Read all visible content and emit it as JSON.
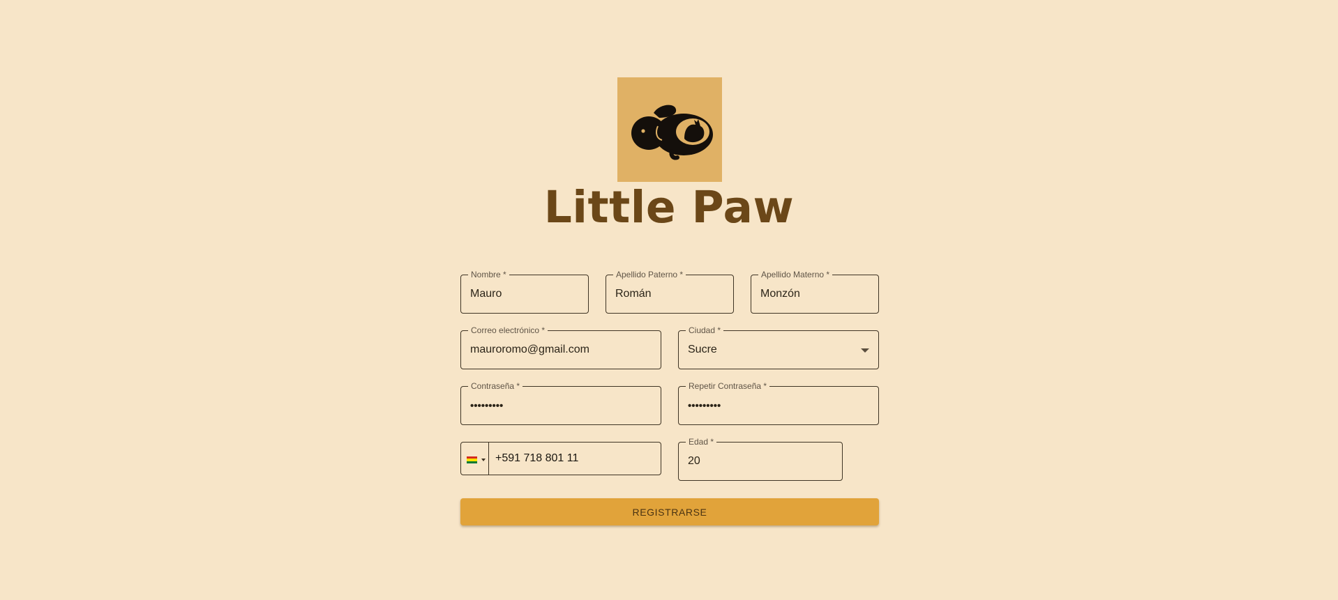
{
  "brand": {
    "title": "Little Paw"
  },
  "form": {
    "nombre": {
      "label": "Nombre *",
      "value": "Mauro"
    },
    "apellido_paterno": {
      "label": "Apellido Paterno *",
      "value": "Román"
    },
    "apellido_materno": {
      "label": "Apellido Materno *",
      "value": "Monzón"
    },
    "correo": {
      "label": "Correo electrónico *",
      "value": "mauroromo@gmail.com"
    },
    "ciudad": {
      "label": "Ciudad *",
      "value": "Sucre"
    },
    "contrasena": {
      "label": "Contraseña *",
      "value": "•••••••••"
    },
    "repetir_contrasena": {
      "label": "Repetir Contraseña *",
      "value": "•••••••••"
    },
    "telefono": {
      "value": "+591 718 801 11",
      "flag_icon": "bolivia-flag-icon",
      "flag_colors": [
        "#d52b1e",
        "#f9e300",
        "#007934"
      ]
    },
    "edad": {
      "label": "Edad *",
      "value": "20"
    },
    "submit_label": "REGISTRARSE"
  },
  "colors": {
    "background": "#f7e5c8",
    "logo_background": "#e0b165",
    "brand_text": "#6b4718",
    "button": "#e1a33a"
  }
}
